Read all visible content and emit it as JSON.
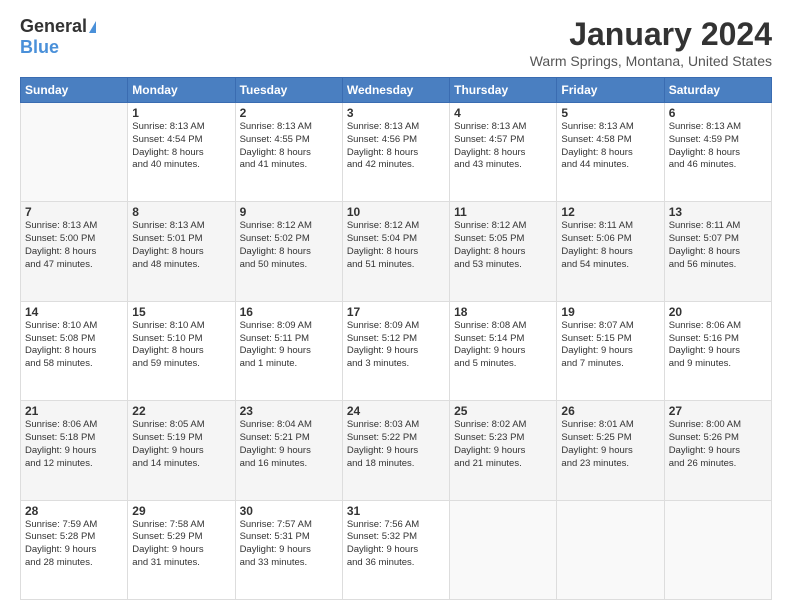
{
  "logo": {
    "general": "General",
    "blue": "Blue"
  },
  "title": "January 2024",
  "subtitle": "Warm Springs, Montana, United States",
  "days_of_week": [
    "Sunday",
    "Monday",
    "Tuesday",
    "Wednesday",
    "Thursday",
    "Friday",
    "Saturday"
  ],
  "weeks": [
    [
      {
        "day": "",
        "info": ""
      },
      {
        "day": "1",
        "info": "Sunrise: 8:13 AM\nSunset: 4:54 PM\nDaylight: 8 hours\nand 40 minutes."
      },
      {
        "day": "2",
        "info": "Sunrise: 8:13 AM\nSunset: 4:55 PM\nDaylight: 8 hours\nand 41 minutes."
      },
      {
        "day": "3",
        "info": "Sunrise: 8:13 AM\nSunset: 4:56 PM\nDaylight: 8 hours\nand 42 minutes."
      },
      {
        "day": "4",
        "info": "Sunrise: 8:13 AM\nSunset: 4:57 PM\nDaylight: 8 hours\nand 43 minutes."
      },
      {
        "day": "5",
        "info": "Sunrise: 8:13 AM\nSunset: 4:58 PM\nDaylight: 8 hours\nand 44 minutes."
      },
      {
        "day": "6",
        "info": "Sunrise: 8:13 AM\nSunset: 4:59 PM\nDaylight: 8 hours\nand 46 minutes."
      }
    ],
    [
      {
        "day": "7",
        "info": "Sunrise: 8:13 AM\nSunset: 5:00 PM\nDaylight: 8 hours\nand 47 minutes."
      },
      {
        "day": "8",
        "info": "Sunrise: 8:13 AM\nSunset: 5:01 PM\nDaylight: 8 hours\nand 48 minutes."
      },
      {
        "day": "9",
        "info": "Sunrise: 8:12 AM\nSunset: 5:02 PM\nDaylight: 8 hours\nand 50 minutes."
      },
      {
        "day": "10",
        "info": "Sunrise: 8:12 AM\nSunset: 5:04 PM\nDaylight: 8 hours\nand 51 minutes."
      },
      {
        "day": "11",
        "info": "Sunrise: 8:12 AM\nSunset: 5:05 PM\nDaylight: 8 hours\nand 53 minutes."
      },
      {
        "day": "12",
        "info": "Sunrise: 8:11 AM\nSunset: 5:06 PM\nDaylight: 8 hours\nand 54 minutes."
      },
      {
        "day": "13",
        "info": "Sunrise: 8:11 AM\nSunset: 5:07 PM\nDaylight: 8 hours\nand 56 minutes."
      }
    ],
    [
      {
        "day": "14",
        "info": "Sunrise: 8:10 AM\nSunset: 5:08 PM\nDaylight: 8 hours\nand 58 minutes."
      },
      {
        "day": "15",
        "info": "Sunrise: 8:10 AM\nSunset: 5:10 PM\nDaylight: 8 hours\nand 59 minutes."
      },
      {
        "day": "16",
        "info": "Sunrise: 8:09 AM\nSunset: 5:11 PM\nDaylight: 9 hours\nand 1 minute."
      },
      {
        "day": "17",
        "info": "Sunrise: 8:09 AM\nSunset: 5:12 PM\nDaylight: 9 hours\nand 3 minutes."
      },
      {
        "day": "18",
        "info": "Sunrise: 8:08 AM\nSunset: 5:14 PM\nDaylight: 9 hours\nand 5 minutes."
      },
      {
        "day": "19",
        "info": "Sunrise: 8:07 AM\nSunset: 5:15 PM\nDaylight: 9 hours\nand 7 minutes."
      },
      {
        "day": "20",
        "info": "Sunrise: 8:06 AM\nSunset: 5:16 PM\nDaylight: 9 hours\nand 9 minutes."
      }
    ],
    [
      {
        "day": "21",
        "info": "Sunrise: 8:06 AM\nSunset: 5:18 PM\nDaylight: 9 hours\nand 12 minutes."
      },
      {
        "day": "22",
        "info": "Sunrise: 8:05 AM\nSunset: 5:19 PM\nDaylight: 9 hours\nand 14 minutes."
      },
      {
        "day": "23",
        "info": "Sunrise: 8:04 AM\nSunset: 5:21 PM\nDaylight: 9 hours\nand 16 minutes."
      },
      {
        "day": "24",
        "info": "Sunrise: 8:03 AM\nSunset: 5:22 PM\nDaylight: 9 hours\nand 18 minutes."
      },
      {
        "day": "25",
        "info": "Sunrise: 8:02 AM\nSunset: 5:23 PM\nDaylight: 9 hours\nand 21 minutes."
      },
      {
        "day": "26",
        "info": "Sunrise: 8:01 AM\nSunset: 5:25 PM\nDaylight: 9 hours\nand 23 minutes."
      },
      {
        "day": "27",
        "info": "Sunrise: 8:00 AM\nSunset: 5:26 PM\nDaylight: 9 hours\nand 26 minutes."
      }
    ],
    [
      {
        "day": "28",
        "info": "Sunrise: 7:59 AM\nSunset: 5:28 PM\nDaylight: 9 hours\nand 28 minutes."
      },
      {
        "day": "29",
        "info": "Sunrise: 7:58 AM\nSunset: 5:29 PM\nDaylight: 9 hours\nand 31 minutes."
      },
      {
        "day": "30",
        "info": "Sunrise: 7:57 AM\nSunset: 5:31 PM\nDaylight: 9 hours\nand 33 minutes."
      },
      {
        "day": "31",
        "info": "Sunrise: 7:56 AM\nSunset: 5:32 PM\nDaylight: 9 hours\nand 36 minutes."
      },
      {
        "day": "",
        "info": ""
      },
      {
        "day": "",
        "info": ""
      },
      {
        "day": "",
        "info": ""
      }
    ]
  ]
}
